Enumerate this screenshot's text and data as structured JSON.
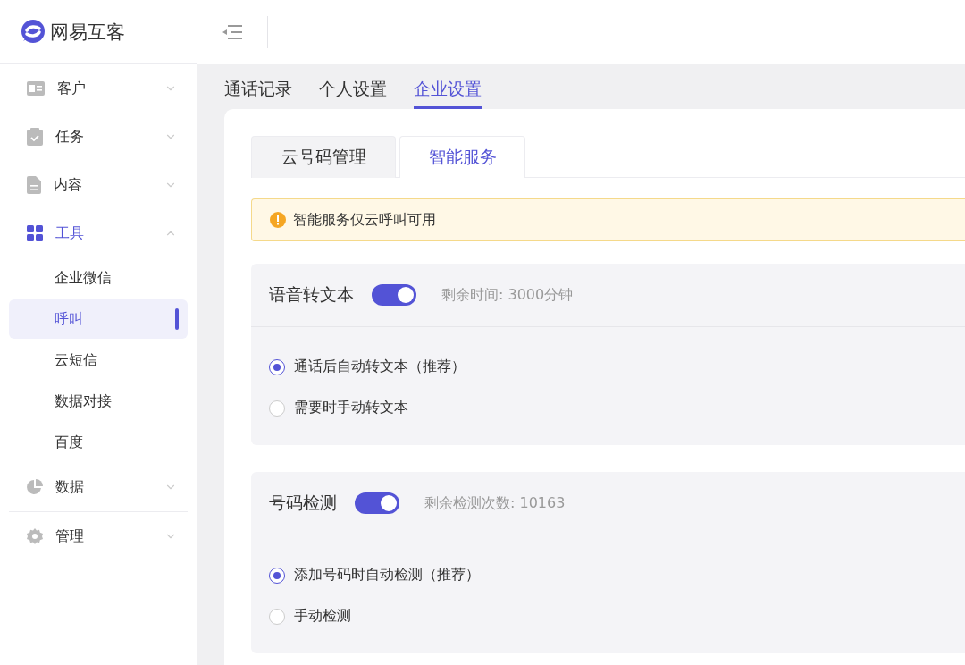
{
  "brand": {
    "name": "网易互客"
  },
  "sidebar": {
    "items": [
      {
        "label": "客户",
        "kind": "card",
        "expanded": false,
        "divider_after": false
      },
      {
        "label": "任务",
        "kind": "clipboard",
        "expanded": false,
        "divider_after": false
      },
      {
        "label": "内容",
        "kind": "file",
        "expanded": false,
        "divider_after": false
      },
      {
        "label": "工具",
        "kind": "grid",
        "expanded": true,
        "divider_after": false,
        "children": [
          {
            "label": "企业微信",
            "selected": false
          },
          {
            "label": "呼叫",
            "selected": true
          },
          {
            "label": "云短信",
            "selected": false
          },
          {
            "label": "数据对接",
            "selected": false
          },
          {
            "label": "百度",
            "selected": false
          }
        ]
      },
      {
        "label": "数据",
        "kind": "pie",
        "expanded": false,
        "divider_after": true
      },
      {
        "label": "管理",
        "kind": "gear",
        "expanded": false,
        "divider_after": false
      }
    ]
  },
  "top_tabs": [
    {
      "label": "通话记录",
      "selected": false
    },
    {
      "label": "个人设置",
      "selected": false
    },
    {
      "label": "企业设置",
      "selected": true
    }
  ],
  "card_tabs": [
    {
      "label": "云号码管理",
      "selected": false
    },
    {
      "label": "智能服务",
      "selected": true
    }
  ],
  "notice": {
    "text": "智能服务仅云呼叫可用"
  },
  "sections": [
    {
      "title": "语音转文本",
      "on": true,
      "info": "剩余时间: 3000分钟",
      "options": [
        {
          "label": "通话后自动转文本（推荐）",
          "selected": true
        },
        {
          "label": "需要时手动转文本",
          "selected": false
        }
      ]
    },
    {
      "title": "号码检测",
      "on": true,
      "info": "剩余检测次数: 10163",
      "options": [
        {
          "label": "添加号码时自动检测（推荐）",
          "selected": true
        },
        {
          "label": "手动检测",
          "selected": false
        }
      ]
    }
  ]
}
